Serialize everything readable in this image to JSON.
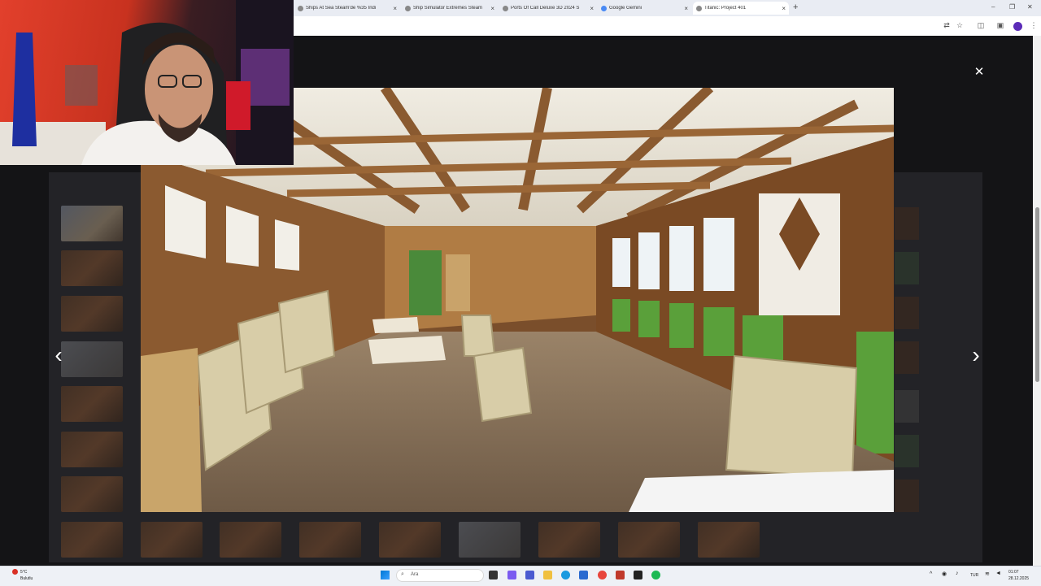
{
  "browser": {
    "tabs": [
      {
        "label": "Ships At Sea Steam'de %35 İndi",
        "active": false
      },
      {
        "label": "Ship Simulator Extremes Steam",
        "active": false
      },
      {
        "label": "Ports Of Call Deluxe 3D 2024 S",
        "active": false
      },
      {
        "label": "Google Gemini",
        "active": false
      },
      {
        "label": "Titanic: Project 401",
        "active": true
      }
    ]
  },
  "lightbox": {
    "close_icon": "close-icon",
    "prev_icon": "chevron-left-icon",
    "next_icon": "chevron-right-icon"
  },
  "taskbar": {
    "weather_temp": "5°C",
    "weather_desc": "Bulutlu",
    "search_label": "Ara",
    "lang": "TUR",
    "time": "01:07",
    "date": "28.12.2025"
  },
  "colors": {
    "page_bg": "#141416",
    "panel_bg": "#232327",
    "lightbox_icon": "#ffffff"
  }
}
